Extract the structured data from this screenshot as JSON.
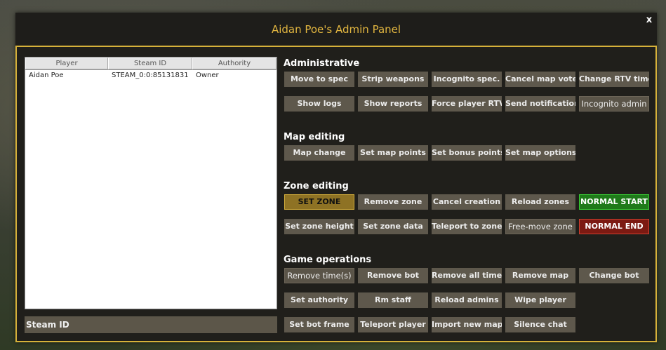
{
  "window": {
    "title": "Aidan Poe's Admin Panel",
    "close_label": "x"
  },
  "table": {
    "headers": [
      "Player",
      "Steam ID",
      "Authority"
    ],
    "rows": [
      {
        "player": "Aidan Poe",
        "steam_id": "STEAM_0:0:85131831",
        "authority": "Owner"
      }
    ]
  },
  "steam_id_label": "Steam ID",
  "sections": {
    "administrative": {
      "title": "Administrative",
      "buttons": [
        "Move to spec",
        "Strip weapons",
        "Incognito spec.",
        "Cancel map vote",
        "Change RTV time",
        "Show logs",
        "Show reports",
        "Force player RTV",
        "Send notification",
        "Incognito admin"
      ]
    },
    "map_editing": {
      "title": "Map editing",
      "buttons": [
        "Map change",
        "Set map points",
        "Set bonus points",
        "Set map options"
      ]
    },
    "zone_editing": {
      "title": "Zone editing",
      "buttons": [
        "SET ZONE",
        "Remove zone",
        "Cancel creation",
        "Reload zones",
        "NORMAL START",
        "Set zone height",
        "Set zone data",
        "Teleport to zone",
        "Free-move zone",
        "NORMAL END"
      ]
    },
    "game_operations": {
      "title": "Game operations",
      "buttons": [
        "Remove time(s)",
        "Remove bot",
        "Remove all times",
        "Remove map",
        "Change bot",
        "Set authority",
        "Rm staff",
        "Reload admins",
        "Wipe player",
        "Set bot frame",
        "Teleport player",
        "Import new map",
        "Silence chat"
      ]
    }
  },
  "colors": {
    "accent": "#d6b13a",
    "title": "#e2b640",
    "active_zone": "#8e7224",
    "start": "#1f7a1a",
    "end": "#7c1a12"
  }
}
